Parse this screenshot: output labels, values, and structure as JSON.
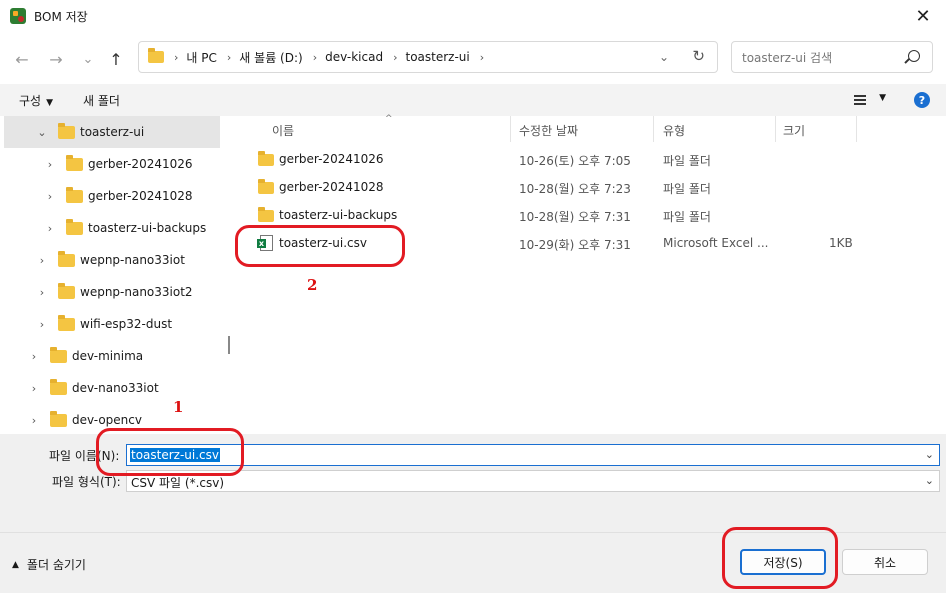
{
  "window": {
    "title": "BOM 저장",
    "close_glyph": "✕"
  },
  "nav_buttons": {
    "back": "←",
    "forward": "→",
    "recent": "⌄",
    "up": "↑"
  },
  "address": {
    "crumbs": [
      "내 PC",
      "새 볼륨 (D:)",
      "dev-kicad",
      "toasterz-ui"
    ],
    "separator": "›",
    "dropdown": "⌄",
    "refresh": "↻"
  },
  "search": {
    "placeholder": "toasterz-ui 검색"
  },
  "toolbar": {
    "organize": "구성",
    "new_folder": "새 폴더",
    "dd": "▼",
    "help": "?"
  },
  "sidebar": {
    "items": [
      {
        "label": "toasterz-ui",
        "chevron": "⌄",
        "selected": true
      },
      {
        "label": "gerber-20241026",
        "chevron": "›"
      },
      {
        "label": "gerber-20241028",
        "chevron": "›"
      },
      {
        "label": "toasterz-ui-backups",
        "chevron": "›"
      },
      {
        "label": "wepnp-nano33iot",
        "chevron": "›"
      },
      {
        "label": "wepnp-nano33iot2",
        "chevron": "›"
      },
      {
        "label": "wifi-esp32-dust",
        "chevron": "›"
      },
      {
        "label": "dev-minima",
        "chevron": "›"
      },
      {
        "label": "dev-nano33iot",
        "chevron": "›"
      },
      {
        "label": "dev-opencv",
        "chevron": "›"
      }
    ]
  },
  "files": {
    "columns": {
      "name": "이름",
      "modified": "수정한 날짜",
      "type": "유형",
      "size": "크기",
      "sort": "^"
    },
    "rows": [
      {
        "name": "gerber-20241026",
        "modified": "10-26(토) 오후 7:05",
        "type": "파일 폴더",
        "size": "",
        "icon": "folder-icon"
      },
      {
        "name": "gerber-20241028",
        "modified": "10-28(월) 오후 7:23",
        "type": "파일 폴더",
        "size": "",
        "icon": "folder-icon"
      },
      {
        "name": "toasterz-ui-backups",
        "modified": "10-28(월) 오후 7:31",
        "type": "파일 폴더",
        "size": "",
        "icon": "folder-icon"
      },
      {
        "name": "toasterz-ui.csv",
        "modified": "10-29(화) 오후 7:31",
        "type": "Microsoft Excel ...",
        "size": "1KB",
        "icon": "excel-csv-icon"
      }
    ]
  },
  "form": {
    "filename_label": "파일 이름(N):",
    "filename_value": "toasterz-ui.csv",
    "filetype_label": "파일 형식(T):",
    "filetype_value": "CSV 파일 (*.csv)",
    "dd": "⌄"
  },
  "footer": {
    "hide_folders": "폴더 숨기기",
    "hide_arrow": "▲",
    "save": "저장(S)",
    "cancel": "취소"
  },
  "annotations": {
    "one": "1",
    "two": "2"
  },
  "colors": {
    "accent": "#1a6fd1",
    "annotation": "#e21b23",
    "folder": "#f4c542",
    "excel": "#107c41"
  }
}
